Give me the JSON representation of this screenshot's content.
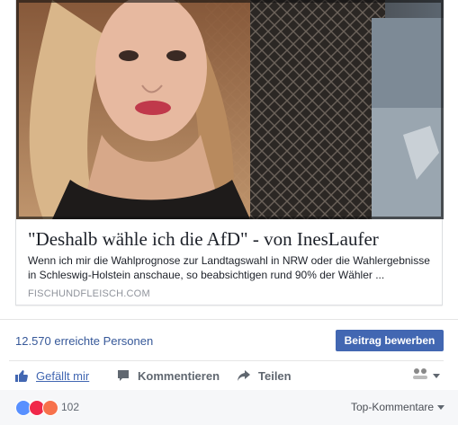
{
  "link_preview": {
    "title": "\"Deshalb wähle ich die AfD\" - von InesLaufer",
    "description": "Wenn ich mir die Wahlprognose zur Landtagswahl in NRW oder die Wahlergebnisse in Schleswig-Holstein anschaue, so beabsichtigen rund 90% der Wähler ...",
    "domain": "FISCHUNDFLEISCH.COM",
    "image_icon": "portrait-photo"
  },
  "insights": {
    "reach_text": "12.570 erreichte Personen",
    "boost_label": "Beitrag bewerben"
  },
  "actions": {
    "like_label": "Gefällt mir",
    "comment_label": "Kommentieren",
    "share_label": "Teilen"
  },
  "reactions": {
    "count": "102",
    "sort_label": "Top-Kommentare",
    "icons": [
      "like-icon",
      "love-icon",
      "angry-icon"
    ]
  },
  "colors": {
    "brand_blue": "#4267b2",
    "link_blue": "#365899",
    "muted_text": "#90949c",
    "footer_bg": "#f6f7f9"
  }
}
